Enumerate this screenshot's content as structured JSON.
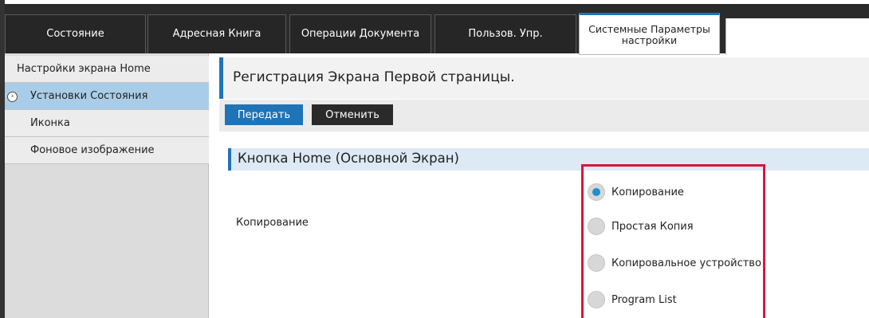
{
  "tabs": [
    {
      "label": "Состояние"
    },
    {
      "label": "Адресная Книга"
    },
    {
      "label": "Операции Документа"
    },
    {
      "label": "Пользов. Упр."
    },
    {
      "label_line1": "Системные Параметры",
      "label_line2": "настройки"
    }
  ],
  "sidebar": {
    "items": [
      {
        "label": "Настройки экрана Home"
      },
      {
        "label": "Установки Состояния"
      },
      {
        "label": "Иконка"
      },
      {
        "label": "Фоновое изображение"
      }
    ]
  },
  "page": {
    "title": "Регистрация Экрана Первой страницы.",
    "send_label": "Передать",
    "cancel_label": "Отменить"
  },
  "section": {
    "title": "Кнопка Home (Основной Экран)",
    "field_label": "Копирование",
    "options": [
      {
        "label": "Копирование",
        "checked": true
      },
      {
        "label": "Простая Копия",
        "checked": false
      },
      {
        "label": "Копировальное устройство",
        "checked": false
      },
      {
        "label": "Program List",
        "checked": false
      }
    ]
  },
  "colors": {
    "accent": "#1f73b7",
    "selected_item": "#a9cde8",
    "highlight": "#d4183d",
    "radio_checked": "#1f8fd0"
  }
}
